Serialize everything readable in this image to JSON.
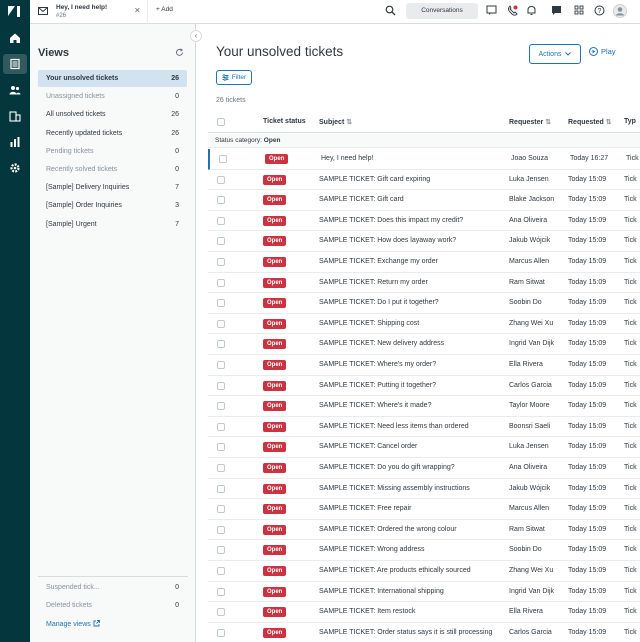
{
  "tab": {
    "title": "Hey, I need help!",
    "number": "#26"
  },
  "topbar": {
    "add_label": "Add",
    "conversations_label": "Conversations"
  },
  "views": {
    "title": "Views",
    "items": [
      {
        "label": "Your unsolved tickets",
        "count": "26",
        "active": true,
        "dim": false
      },
      {
        "label": "Unassigned tickets",
        "count": "0",
        "active": false,
        "dim": true
      },
      {
        "label": "All unsolved tickets",
        "count": "26",
        "active": false,
        "dim": false
      },
      {
        "label": "Recently updated tickets",
        "count": "26",
        "active": false,
        "dim": false
      },
      {
        "label": "Pending tickets",
        "count": "0",
        "active": false,
        "dim": true
      },
      {
        "label": "Recently solved tickets",
        "count": "0",
        "active": false,
        "dim": true
      },
      {
        "label": "[Sample] Delivery Inquiries",
        "count": "7",
        "active": false,
        "dim": false
      },
      {
        "label": "[Sample] Order Inquiries",
        "count": "3",
        "active": false,
        "dim": false
      },
      {
        "label": "[Sample] Urgent",
        "count": "7",
        "active": false,
        "dim": false
      }
    ],
    "bottom_items": [
      {
        "label": "Suspended tick...",
        "count": "0"
      },
      {
        "label": "Deleted tickets",
        "count": "0"
      }
    ],
    "manage_label": "Manage views"
  },
  "main": {
    "heading": "Your unsolved tickets",
    "actions_label": "Actions",
    "play_label": "Play",
    "filter_label": "Filter",
    "count_label": "26 tickets",
    "columns": {
      "status": "Ticket status",
      "subject": "Subject",
      "requester": "Requester",
      "requested": "Requested",
      "type": "Typ"
    },
    "group_prefix": "Status category:",
    "group_value": "Open",
    "status_badge": "Open",
    "rows": [
      {
        "subject": "Hey, I need help!",
        "requester": "Joao Souza",
        "requested": "Today 16:27",
        "type": "Tick"
      },
      {
        "subject": "SAMPLE TICKET: Gift card expiring",
        "requester": "Luka Jensen",
        "requested": "Today 15:09",
        "type": "Tick"
      },
      {
        "subject": "SAMPLE TICKET: Gift card",
        "requester": "Blake Jackson",
        "requested": "Today 15:09",
        "type": "Tick"
      },
      {
        "subject": "SAMPLE TICKET: Does this impact my credit?",
        "requester": "Ana Oliveira",
        "requested": "Today 15:09",
        "type": "Tick"
      },
      {
        "subject": "SAMPLE TICKET: How does layaway work?",
        "requester": "Jakub Wójcik",
        "requested": "Today 15:09",
        "type": "Tick"
      },
      {
        "subject": "SAMPLE TICKET: Exchange my order",
        "requester": "Marcus Allen",
        "requested": "Today 15:09",
        "type": "Tick"
      },
      {
        "subject": "SAMPLE TICKET: Return my order",
        "requester": "Ram Sitwat",
        "requested": "Today 15:09",
        "type": "Tick"
      },
      {
        "subject": "SAMPLE TICKET: Do I put it together?",
        "requester": "Soobin Do",
        "requested": "Today 15:09",
        "type": "Tick"
      },
      {
        "subject": "SAMPLE TICKET: Shipping cost",
        "requester": "Zhang Wei Xu",
        "requested": "Today 15:09",
        "type": "Tick"
      },
      {
        "subject": "SAMPLE TICKET: New delivery address",
        "requester": "Ingrid Van Dijk",
        "requested": "Today 15:09",
        "type": "Tick"
      },
      {
        "subject": "SAMPLE TICKET: Where's my order?",
        "requester": "Ella Rivera",
        "requested": "Today 15:09",
        "type": "Tick"
      },
      {
        "subject": "SAMPLE TICKET: Putting it together?",
        "requester": "Carlos Garcia",
        "requested": "Today 15:09",
        "type": "Tick"
      },
      {
        "subject": "SAMPLE TICKET: Where's it made?",
        "requester": "Taylor Moore",
        "requested": "Today 15:09",
        "type": "Tick"
      },
      {
        "subject": "SAMPLE TICKET: Need less items than ordered",
        "requester": "Boonsri Saeli",
        "requested": "Today 15:09",
        "type": "Tick"
      },
      {
        "subject": "SAMPLE TICKET: Cancel order",
        "requester": "Luka Jensen",
        "requested": "Today 15:09",
        "type": "Tick"
      },
      {
        "subject": "SAMPLE TICKET: Do you do gift wrapping?",
        "requester": "Ana Oliveira",
        "requested": "Today 15:09",
        "type": "Tick"
      },
      {
        "subject": "SAMPLE TICKET: Missing assembly instructions",
        "requester": "Jakub Wójcik",
        "requested": "Today 15:09",
        "type": "Tick"
      },
      {
        "subject": "SAMPLE TICKET: Free repair",
        "requester": "Marcus Allen",
        "requested": "Today 15:09",
        "type": "Tick"
      },
      {
        "subject": "SAMPLE TICKET: Ordered the wrong colour",
        "requester": "Ram Sitwat",
        "requested": "Today 15:09",
        "type": "Tick"
      },
      {
        "subject": "SAMPLE TICKET: Wrong address",
        "requester": "Soobin Do",
        "requested": "Today 15:09",
        "type": "Tick"
      },
      {
        "subject": "SAMPLE TICKET: Are products ethically sourced",
        "requester": "Zhang Wei Xu",
        "requested": "Today 15:09",
        "type": "Tick"
      },
      {
        "subject": "SAMPLE TICKET: International shipping",
        "requester": "Ingrid Van Dijk",
        "requested": "Today 15:09",
        "type": "Tick"
      },
      {
        "subject": "SAMPLE TICKET: Item restock",
        "requester": "Ella Rivera",
        "requested": "Today 15:09",
        "type": "Tick"
      },
      {
        "subject": "SAMPLE TICKET: Order status says it is still processing",
        "requester": "Carlos Garcia",
        "requested": "Today 15:09",
        "type": "Tick"
      }
    ]
  },
  "colors": {
    "rail": "#03363d",
    "accent": "#1f73b7",
    "open_badge": "#cc3340",
    "active_view": "#d2e2ee"
  },
  "icons": [
    "zendesk-logo",
    "home-icon",
    "views-icon",
    "customers-icon",
    "organizations-icon",
    "reporting-icon",
    "admin-gear-icon",
    "mail-icon",
    "search-icon",
    "chat-icon",
    "notification-icon",
    "bell-icon",
    "messages-icon",
    "apps-grid-icon",
    "help-icon",
    "avatar",
    "refresh-icon",
    "play-icon",
    "filter-icon",
    "external-link-icon"
  ]
}
